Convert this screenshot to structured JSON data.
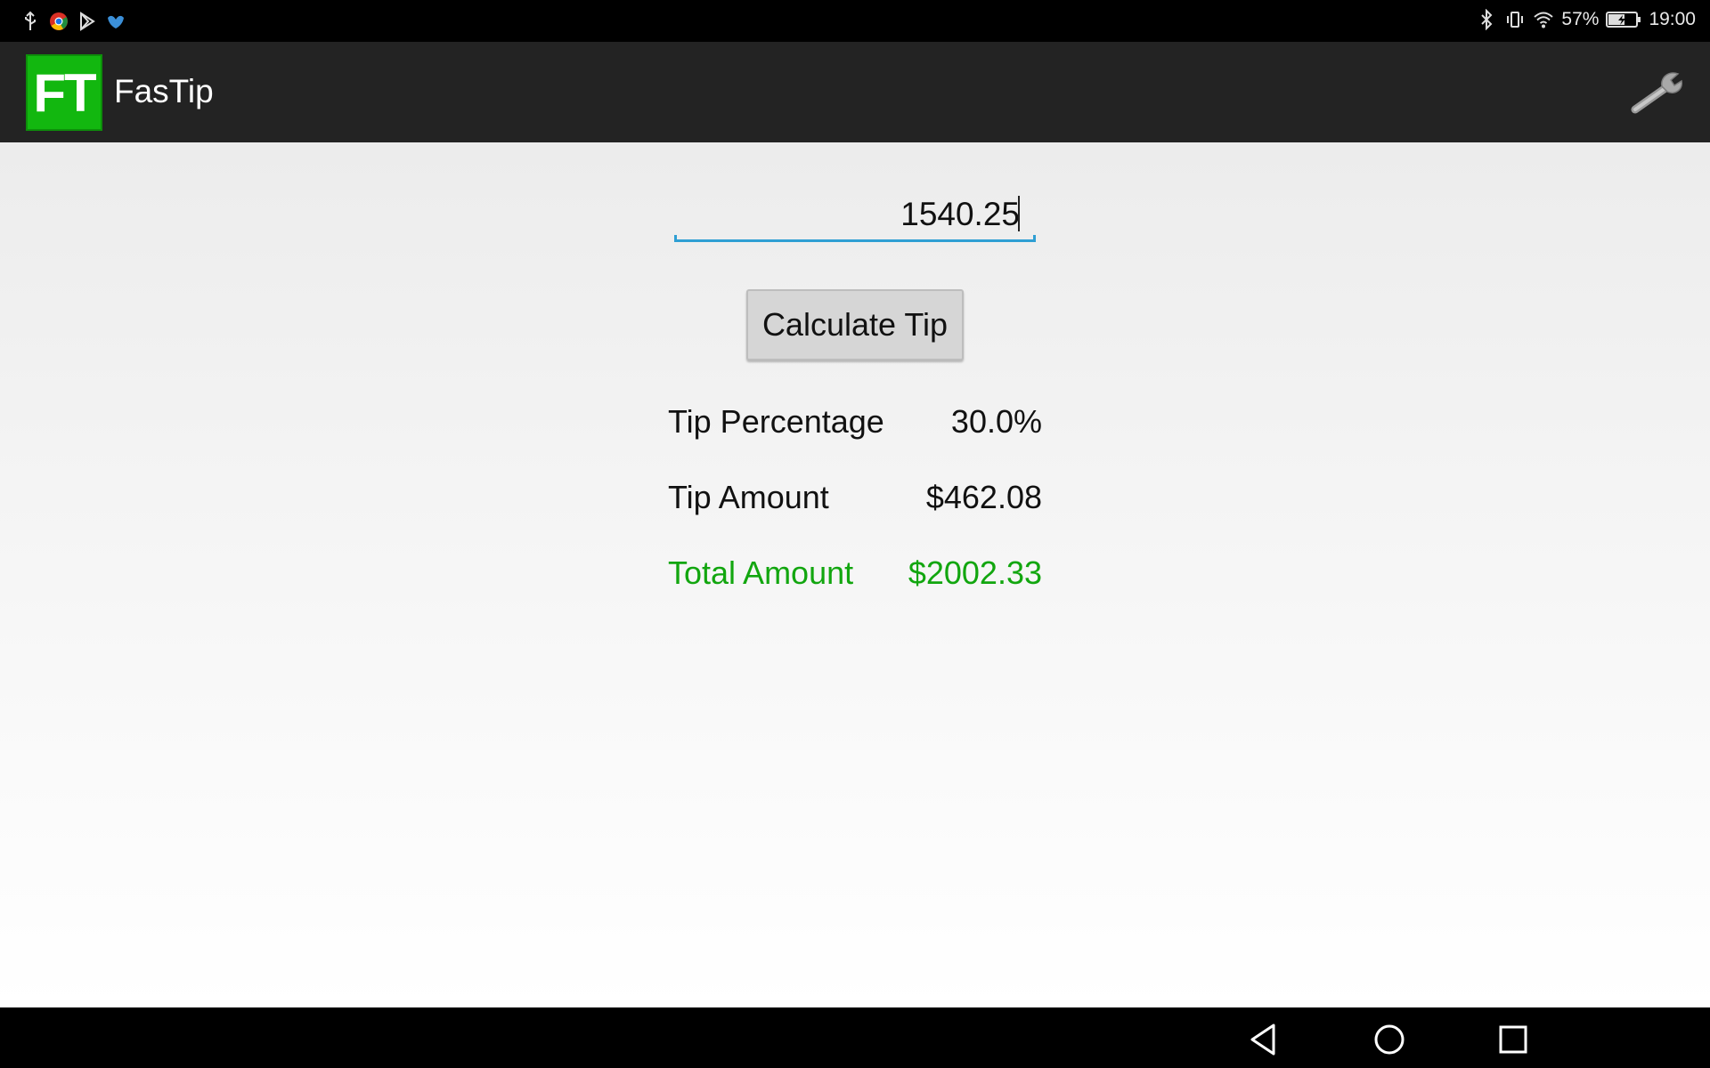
{
  "status_bar": {
    "battery_percent": "57%",
    "time": "19:00",
    "icons_left": [
      "usb-icon",
      "chrome-icon",
      "play-store-icon",
      "bird-app-icon"
    ],
    "icons_right": [
      "bluetooth-icon",
      "vibrate-icon",
      "wifi-icon",
      "battery-charging-icon"
    ]
  },
  "action_bar": {
    "logo_text": "FT",
    "title": "FasTip",
    "settings_icon": "wrench-icon",
    "logo_color": "#12b70f"
  },
  "form": {
    "bill_value": "1540.25",
    "calculate_label": "Calculate Tip"
  },
  "results": {
    "tip_percentage_label": "Tip Percentage",
    "tip_percentage_value": "30.0%",
    "tip_amount_label": "Tip Amount",
    "tip_amount_value": "$462.08",
    "total_amount_label": "Total Amount",
    "total_amount_value": "$2002.33",
    "total_color": "#12a60f"
  },
  "nav_bar": {
    "buttons": [
      "back-icon",
      "home-icon",
      "recents-icon"
    ]
  }
}
